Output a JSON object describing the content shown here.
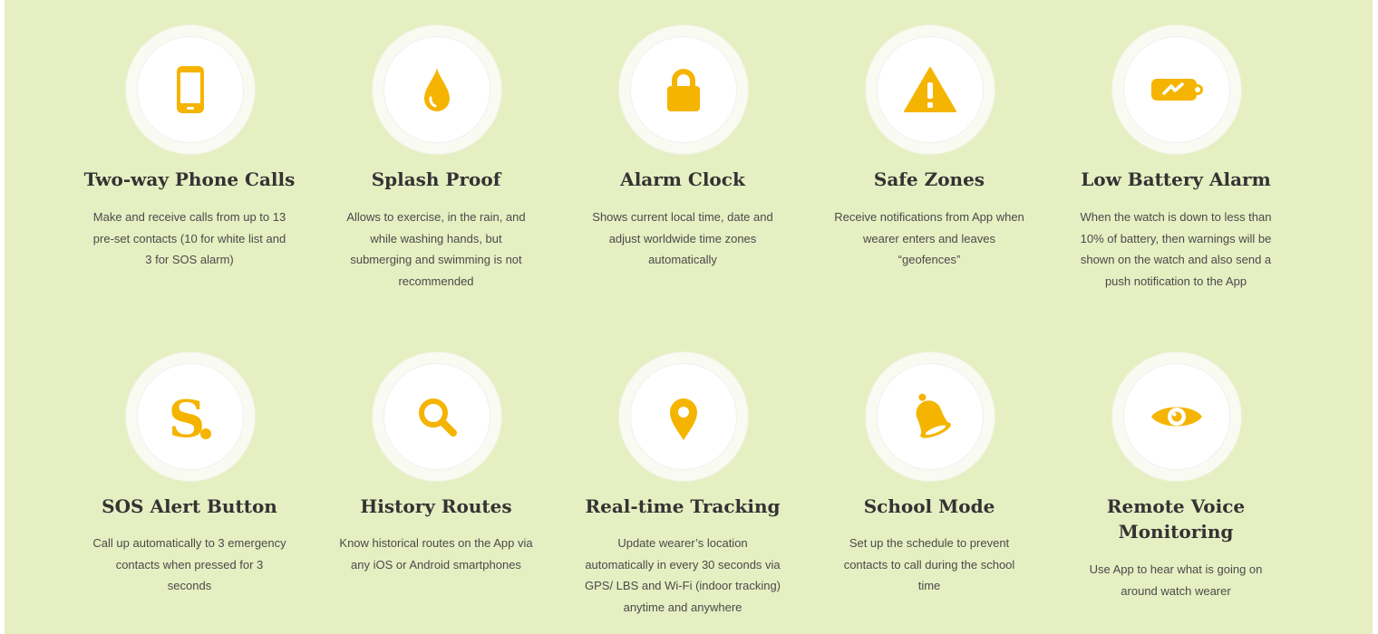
{
  "accent_color": "#f5b400",
  "features": [
    {
      "icon": "phone-icon",
      "title_lines": [
        "Two-way Phone Calls"
      ],
      "desc_lines": [
        "Make and receive calls from up to 13",
        "pre-set contacts (10 for white list and",
        "3 for SOS alarm)"
      ]
    },
    {
      "icon": "water-drop-icon",
      "title_lines": [
        "Splash Proof"
      ],
      "desc_lines": [
        "Allows to exercise, in the rain, and",
        "while washing hands, but",
        "submerging and swimming is not",
        "recommended"
      ]
    },
    {
      "icon": "lock-icon",
      "title_lines": [
        "Alarm Clock"
      ],
      "desc_lines": [
        "Shows current local time, date and",
        "adjust worldwide time zones",
        "automatically"
      ]
    },
    {
      "icon": "warning-icon",
      "title_lines": [
        "Safe Zones"
      ],
      "desc_lines": [
        "Receive notifications from App when",
        "wearer enters and leaves",
        "“geofences”"
      ]
    },
    {
      "icon": "battery-icon",
      "title_lines": [
        "Low Battery Alarm"
      ],
      "desc_lines": [
        "When the watch is down to less than",
        "10% of battery, then warnings will be",
        "shown on the watch and also send a",
        "push notification to the App"
      ]
    },
    {
      "icon": "sos-s-icon",
      "icon_text": "S",
      "title_lines": [
        "SOS Alert Button"
      ],
      "desc_lines": [
        "Call up automatically to 3 emergency",
        "contacts when pressed for 3",
        "seconds"
      ]
    },
    {
      "icon": "search-icon",
      "title_lines": [
        "History Routes"
      ],
      "desc_lines": [
        "Know historical routes on the App via",
        "any iOS or Android smartphones"
      ]
    },
    {
      "icon": "map-pin-icon",
      "title_lines": [
        "Real-time Tracking"
      ],
      "desc_lines": [
        "Update wearer’s location",
        "automatically in every 30 seconds via",
        "GPS/ LBS and Wi-Fi (indoor tracking)",
        "anytime and anywhere"
      ]
    },
    {
      "icon": "bell-icon",
      "title_lines": [
        "School Mode"
      ],
      "desc_lines": [
        "Set up the schedule to prevent",
        "contacts to call during the school",
        "time"
      ]
    },
    {
      "icon": "eye-icon",
      "title_lines": [
        "Remote Voice",
        "Monitoring"
      ],
      "desc_lines": [
        "Use App to hear what is going on",
        "around watch wearer"
      ]
    }
  ]
}
